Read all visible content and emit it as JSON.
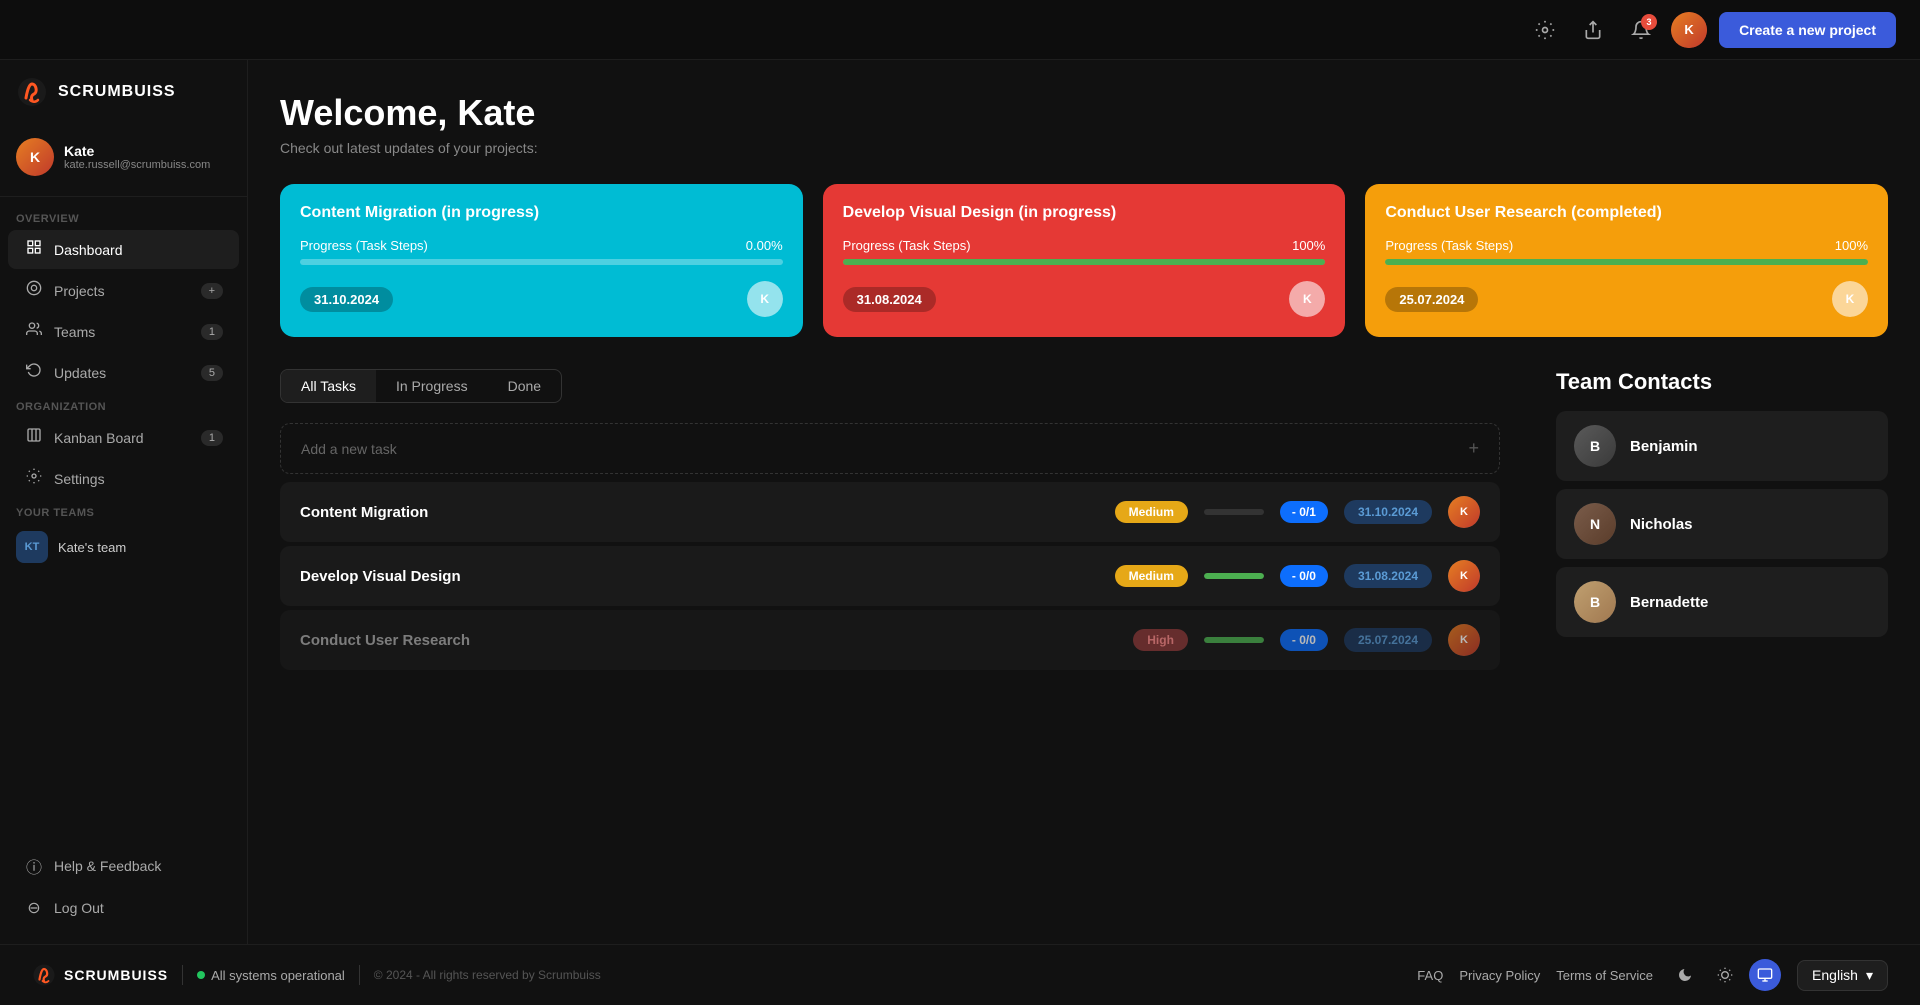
{
  "app": {
    "name": "SCRUMBUISS",
    "tagline": "scrumbuiss"
  },
  "topbar": {
    "create_button": "Create a new project",
    "notification_count": "3"
  },
  "sidebar": {
    "user": {
      "name": "Kate",
      "email": "kate.russell@scrumbuiss.com"
    },
    "sections": {
      "overview": "Overview",
      "organization": "Organization",
      "your_teams": "Your Teams"
    },
    "nav": [
      {
        "id": "dashboard",
        "label": "Dashboard",
        "icon": "⊙",
        "badge": null,
        "active": true
      },
      {
        "id": "projects",
        "label": "Projects",
        "icon": "◎",
        "badge": "+",
        "active": false
      },
      {
        "id": "teams",
        "label": "Teams",
        "icon": "⊛",
        "badge": "1",
        "active": false
      },
      {
        "id": "updates",
        "label": "Updates",
        "icon": "↻",
        "badge": "5",
        "active": false
      }
    ],
    "org_nav": [
      {
        "id": "kanban",
        "label": "Kanban Board",
        "icon": "⊞",
        "badge": "1"
      },
      {
        "id": "settings",
        "label": "Settings",
        "icon": "⚙",
        "badge": null
      }
    ],
    "teams": [
      {
        "id": "kates-team",
        "initials": "KT",
        "name": "Kate's team"
      }
    ],
    "bottom": [
      {
        "id": "help",
        "label": "Help & Feedback",
        "icon": "ⓘ"
      },
      {
        "id": "logout",
        "label": "Log Out",
        "icon": "⊖"
      }
    ]
  },
  "welcome": {
    "title": "Welcome, Kate",
    "subtitle": "Check out latest updates of your projects:"
  },
  "project_cards": [
    {
      "id": "content-migration",
      "title": "Content Migration (in progress)",
      "progress_label": "Progress (Task Steps)",
      "progress_value": "0.00%",
      "progress_pct": 0,
      "date": "31.10.2024",
      "color": "blue"
    },
    {
      "id": "develop-visual",
      "title": "Develop Visual Design (in progress)",
      "progress_label": "Progress (Task Steps)",
      "progress_value": "100%",
      "progress_pct": 100,
      "date": "31.08.2024",
      "color": "red"
    },
    {
      "id": "user-research",
      "title": "Conduct User Research (completed)",
      "progress_label": "Progress (Task Steps)",
      "progress_value": "100%",
      "progress_pct": 100,
      "date": "25.07.2024",
      "color": "orange"
    }
  ],
  "task_filter": {
    "tabs": [
      "All Tasks",
      "In Progress",
      "Done"
    ],
    "active": "All Tasks"
  },
  "tasks": {
    "add_placeholder": "Add a new task",
    "add_icon": "+",
    "items": [
      {
        "id": "t1",
        "name": "Content Migration",
        "priority": "Medium",
        "priority_type": "medium",
        "progress_pct": 0,
        "count": "- 0/1",
        "date": "31.10.2024"
      },
      {
        "id": "t2",
        "name": "Develop Visual Design",
        "priority": "Medium",
        "priority_type": "medium",
        "progress_pct": 100,
        "count": "- 0/0",
        "date": "31.08.2024"
      },
      {
        "id": "t3",
        "name": "Conduct User Research",
        "priority": "High",
        "priority_type": "high",
        "progress_pct": 100,
        "count": "- 0/0",
        "date": "25.07.2024"
      }
    ]
  },
  "team_contacts": {
    "title": "Team Contacts",
    "members": [
      {
        "id": "benjamin",
        "name": "Benjamin"
      },
      {
        "id": "nicholas",
        "name": "Nicholas"
      },
      {
        "id": "bernadette",
        "name": "Bernadette"
      }
    ]
  },
  "footer": {
    "brand": "SCRUMBUISS",
    "status_text": "All systems operational",
    "copyright": "© 2024 - All rights reserved by Scrumbuiss",
    "links": [
      "FAQ",
      "Privacy Policy",
      "Terms of Service"
    ],
    "language": "English",
    "language_chevron": "▾"
  }
}
